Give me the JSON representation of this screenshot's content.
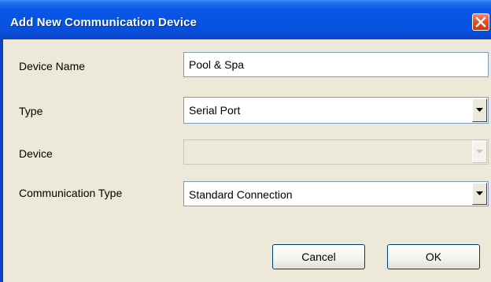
{
  "dialog": {
    "title": "Add New Communication Device"
  },
  "form": {
    "device_name": {
      "label": "Device Name",
      "value": "Pool & Spa"
    },
    "type": {
      "label": "Type",
      "value": "Serial Port"
    },
    "device": {
      "label": "Device",
      "value": "",
      "disabled": true
    },
    "communication_type": {
      "label": "Communication Type",
      "value": "Standard Connection"
    }
  },
  "buttons": {
    "cancel": "Cancel",
    "ok": "OK"
  },
  "icons": {
    "close": "close-icon",
    "dropdown": "chevron-down-icon"
  },
  "colors": {
    "titlebar": "#0554e0",
    "client_bg": "#ece9d8",
    "close_button": "#e2502c",
    "field_border": "#7f9db9"
  }
}
